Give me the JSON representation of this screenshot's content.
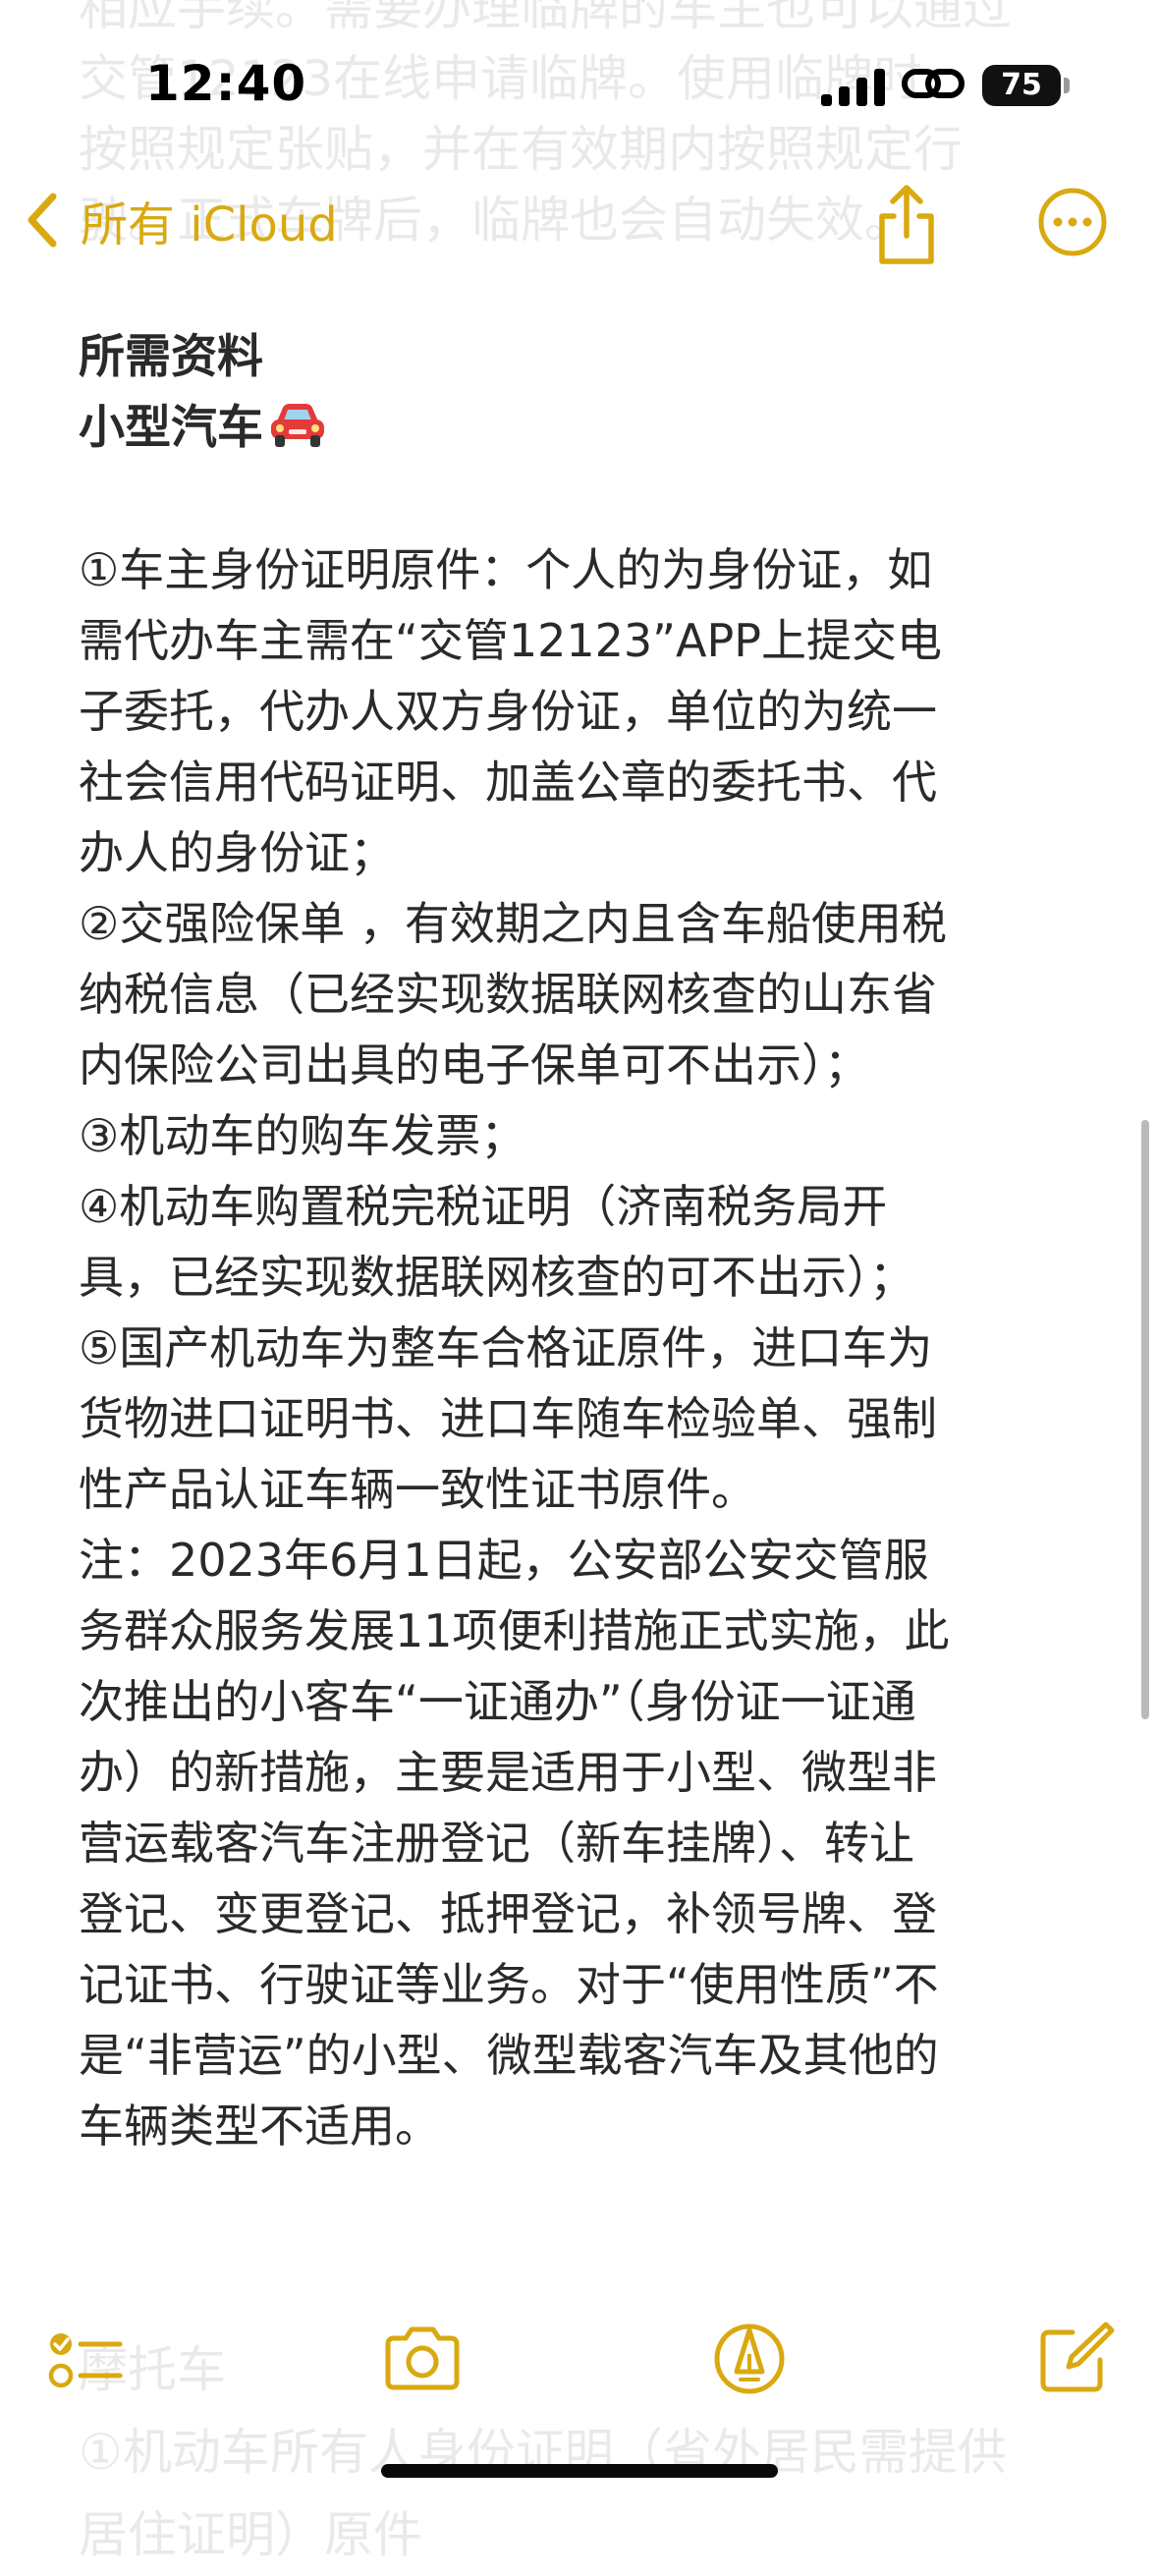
{
  "status_bar": {
    "time": "12:40",
    "battery": "75"
  },
  "nav": {
    "back_label": "所有 iCloud",
    "icons": [
      "chevron-left-icon",
      "share-icon",
      "ellipsis-circle-icon"
    ]
  },
  "faded_top_lines": [
    "相应手续。需要办理临牌的车主也可以通过",
    "交管12123在线申请临牌。使用临牌时",
    "按照规定张贴，并在有效期内按照规定行",
    "驶。正式车牌后，临牌也会自动失效。"
  ],
  "note": {
    "heading": "所需资料",
    "subheading": "小型汽车",
    "subheading_icon": "car-icon",
    "lines": [
      "①车主身份证明原件：个人的为身份证，如",
      "需代办车主需在“交管12123”APP上提交电",
      "子委托，代办人双方身份证，单位的为统一",
      "社会信用代码证明、加盖公章的委托书、代",
      "办人的身份证；",
      "②交强险保单 ，有效期之内且含车船使用税",
      "纳税信息（已经实现数据联网核查的山东省",
      "内保险公司出具的电子保单可不出示）；",
      "③机动车的购车发票；",
      "④机动车购置税完税证明（济南税务局开",
      "具，已经实现数据联网核查的可不出示）；",
      "⑤国产机动车为整车合格证原件，进口车为",
      "货物进口证明书、进口车随车检验单、强制",
      "性产品认证车辆一致性证书原件。",
      "注：2023年6月1日起，公安部公安交管服",
      "务群众服务发展11项便利措施正式实施，此",
      "次推出的小客车“一证通办”（身份证一证通",
      "办）的新措施，主要是适用于小型、微型非",
      "营运载客汽车注册登记（新车挂牌）、转让",
      "登记、变更登记、抵押登记，补领号牌、登",
      "记证书、行驶证等业务。对于“使用性质”不",
      "是“非营运”的小型、微型载客汽车及其他的",
      "车辆类型不适用。"
    ]
  },
  "faded_bottom_lines": [
    "摩托车",
    "①机动车所有人身份证明（省外居民需提供",
    "居住证明）原件"
  ],
  "toolbar": {
    "icons": [
      "checklist-icon",
      "camera-icon",
      "markup-pen-icon",
      "compose-icon"
    ]
  },
  "colors": {
    "accent": "#d9a90f",
    "text": "#2a2a2a",
    "background": "#ffffff"
  }
}
